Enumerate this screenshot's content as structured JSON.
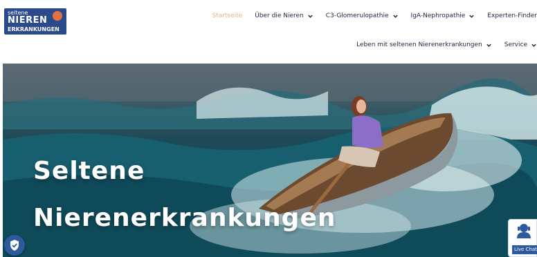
{
  "logo": {
    "line1": "seltene",
    "line2": "NIEREN",
    "line3": "ERKRANKUNGEN"
  },
  "nav": {
    "row1": [
      {
        "label": "Startseite",
        "active": true,
        "has_dropdown": false
      },
      {
        "label": "Über die Nieren",
        "active": false,
        "has_dropdown": true
      },
      {
        "label": "C3-Glomerulopathie",
        "active": false,
        "has_dropdown": true
      },
      {
        "label": "IgA-Nephropathie",
        "active": false,
        "has_dropdown": true
      },
      {
        "label": "Experten-Finder",
        "active": false,
        "has_dropdown": false
      }
    ],
    "row2": [
      {
        "label": "Leben mit seltenen Nierenerkrankungen",
        "active": false,
        "has_dropdown": true
      },
      {
        "label": "Service",
        "active": false,
        "has_dropdown": true
      }
    ]
  },
  "hero": {
    "title_line1": "Seltene",
    "title_line2": "Nierenerkrankungen"
  },
  "chat": {
    "label": "Live Chat"
  },
  "colors": {
    "brand_blue": "#2a4a8c",
    "active_nav": "#e8b48a",
    "nav_text": "#1c2440",
    "sea": "#14505e"
  },
  "icons": {
    "privacy": "shield-check-icon",
    "chat": "person-chat-icon",
    "dropdown": "chevron-down-icon"
  }
}
